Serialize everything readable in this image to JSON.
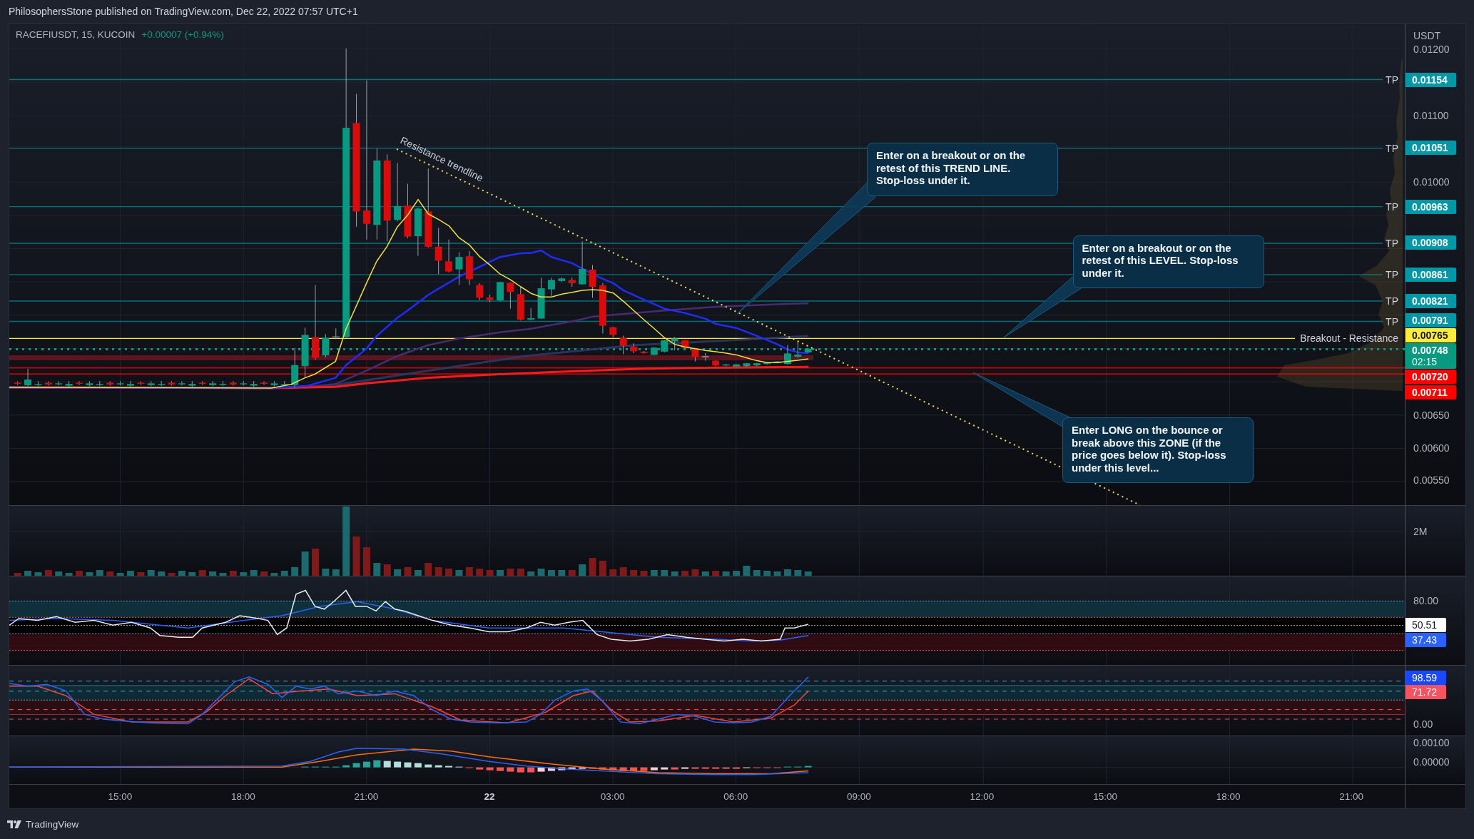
{
  "header": {
    "text": "PhilosophersStone published on TradingView.com, Dec 22, 2022 07:57 UTC+1"
  },
  "symbol": {
    "name": "RACEFIUSDT, 15, KUCOIN",
    "change": "+0.00007 (+0.94%)"
  },
  "price_axis": {
    "unit": "USDT",
    "ticks": [
      "0.01200",
      "0.01100",
      "0.01000",
      "0.00650",
      "0.00600",
      "0.00550"
    ]
  },
  "levels": [
    {
      "kind": "target",
      "label": "TP",
      "price": "0.01154",
      "color": "#0097a7"
    },
    {
      "kind": "target",
      "label": "TP",
      "price": "0.01051",
      "color": "#0097a7"
    },
    {
      "kind": "target",
      "label": "TP",
      "price": "0.00963",
      "color": "#0097a7"
    },
    {
      "kind": "target",
      "label": "TP",
      "price": "0.00908",
      "color": "#0097a7"
    },
    {
      "kind": "target",
      "label": "TP",
      "price": "0.00861",
      "color": "#0097a7"
    },
    {
      "kind": "target",
      "label": "TP",
      "price": "0.00821",
      "color": "#0097a7"
    },
    {
      "kind": "target",
      "label": "TP",
      "price": "0.00791",
      "color": "#0097a7"
    },
    {
      "kind": "breakout",
      "label": "Breakout - Resistance",
      "price": "0.00765",
      "color": "#ffeb3b"
    },
    {
      "kind": "last",
      "price": "0.00748",
      "countdown": "02:15",
      "color": "#089981"
    },
    {
      "kind": "stop",
      "price": "0.00720",
      "color": "#ff0000"
    },
    {
      "kind": "stop",
      "price": "0.00711",
      "color": "#ff0000"
    }
  ],
  "trendline": {
    "label": "Resistance trendline"
  },
  "callouts": [
    {
      "lines": [
        "Enter on a breakout or on the",
        "retest of this TREND LINE.",
        "Stop-loss under it."
      ]
    },
    {
      "lines": [
        "Enter on a breakout or on the",
        "retest of this LEVEL. Stop-loss",
        "under it."
      ]
    },
    {
      "lines": [
        "Enter LONG on the bounce or",
        "break above this ZONE (if the",
        "price goes below it). Stop-loss",
        "under this level..."
      ]
    }
  ],
  "volume": {
    "axis_label": "2M"
  },
  "rsi": {
    "axis_label": "80.00",
    "tags": [
      {
        "text": "50.51",
        "color": "#ffffff"
      },
      {
        "text": "37.43",
        "color": "#2962ff"
      }
    ]
  },
  "stochastic": {
    "axis_label": "0.00",
    "tags": [
      {
        "text": "98.59",
        "color": "#1848ff"
      },
      {
        "text": "71.72",
        "color": "#f7525f"
      }
    ]
  },
  "macd": {
    "axis_labels": [
      "0.00100",
      "0.00000"
    ]
  },
  "time_axis": [
    {
      "text": "15:00",
      "kind": "time"
    },
    {
      "text": "18:00",
      "kind": "time"
    },
    {
      "text": "21:00",
      "kind": "time"
    },
    {
      "text": "22",
      "kind": "day"
    },
    {
      "text": "03:00",
      "kind": "time"
    },
    {
      "text": "06:00",
      "kind": "time"
    },
    {
      "text": "09:00",
      "kind": "time"
    },
    {
      "text": "12:00",
      "kind": "time"
    },
    {
      "text": "15:00",
      "kind": "time"
    },
    {
      "text": "18:00",
      "kind": "time"
    },
    {
      "text": "21:00",
      "kind": "time"
    }
  ],
  "footer": {
    "brand": "TradingView"
  }
}
